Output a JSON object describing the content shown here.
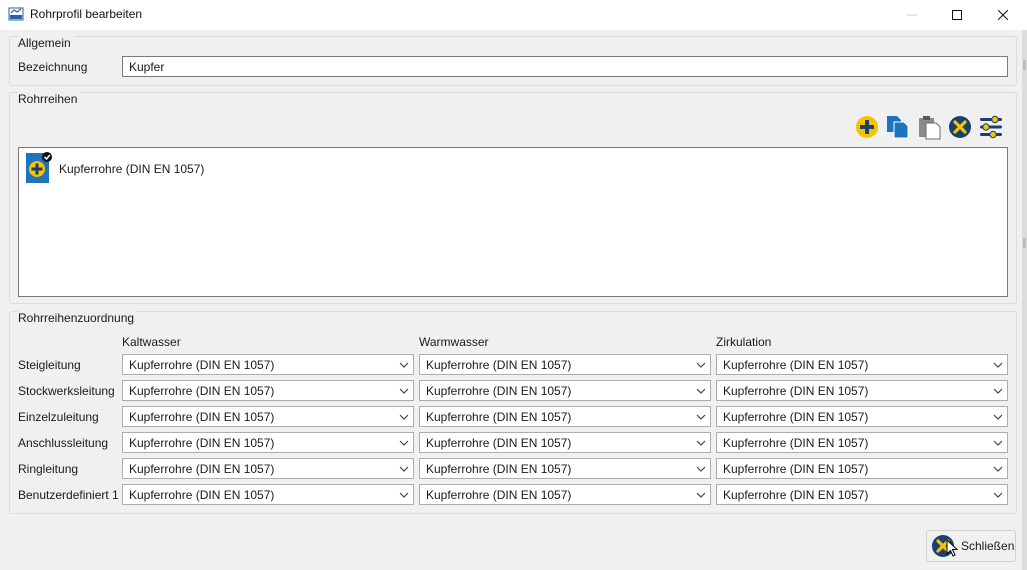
{
  "window": {
    "title": "Rohrprofil bearbeiten"
  },
  "allgemein": {
    "title": "Allgemein",
    "bezeichnung_label": "Bezeichnung",
    "bezeichnung_value": "Kupfer"
  },
  "rohrreihen": {
    "title": "Rohrreihen",
    "toolbar": [
      "add-icon",
      "copy-icon",
      "paste-icon",
      "delete-icon",
      "settings-icon"
    ],
    "items": [
      {
        "label": "Kupferrohre (DIN EN 1057)"
      }
    ]
  },
  "zuordnung": {
    "title": "Rohrreihenzuordnung",
    "columns": [
      "Kaltwasser",
      "Warmwasser",
      "Zirkulation"
    ],
    "rows": [
      {
        "label": "Steigleitung",
        "values": [
          "Kupferrohre (DIN EN 1057)",
          "Kupferrohre (DIN EN 1057)",
          "Kupferrohre (DIN EN 1057)"
        ]
      },
      {
        "label": "Stockwerksleitung",
        "values": [
          "Kupferrohre (DIN EN 1057)",
          "Kupferrohre (DIN EN 1057)",
          "Kupferrohre (DIN EN 1057)"
        ]
      },
      {
        "label": "Einzelzuleitung",
        "values": [
          "Kupferrohre (DIN EN 1057)",
          "Kupferrohre (DIN EN 1057)",
          "Kupferrohre (DIN EN 1057)"
        ]
      },
      {
        "label": "Anschlussleitung",
        "values": [
          "Kupferrohre (DIN EN 1057)",
          "Kupferrohre (DIN EN 1057)",
          "Kupferrohre (DIN EN 1057)"
        ]
      },
      {
        "label": "Ringleitung",
        "values": [
          "Kupferrohre (DIN EN 1057)",
          "Kupferrohre (DIN EN 1057)",
          "Kupferrohre (DIN EN 1057)"
        ]
      },
      {
        "label": "Benutzerdefiniert 1",
        "values": [
          "Kupferrohre (DIN EN 1057)",
          "Kupferrohre (DIN EN 1057)",
          "Kupferrohre (DIN EN 1057)"
        ]
      }
    ]
  },
  "footer": {
    "close_label": "Schließen"
  },
  "colors": {
    "accent_yellow": "#f5c400",
    "accent_blue": "#1e73be",
    "dark_blue": "#1b3f6e"
  }
}
